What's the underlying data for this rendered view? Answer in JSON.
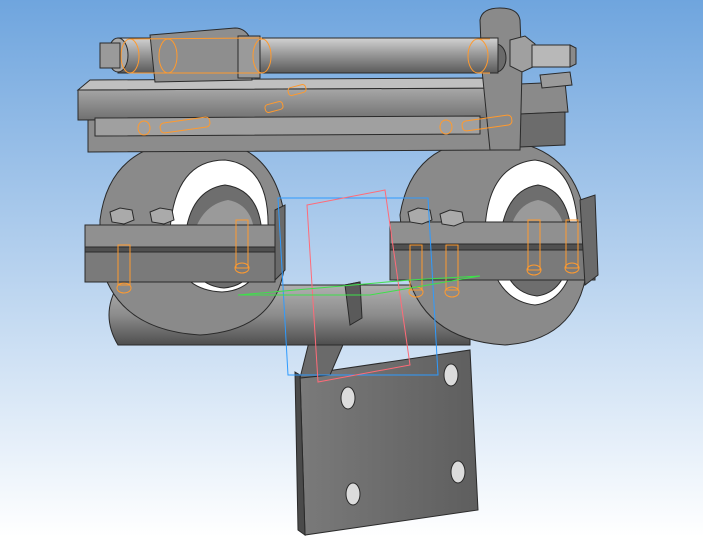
{
  "viewport": {
    "background_top": "#6fa5de",
    "background_bottom": "#ffffff",
    "model_fill": "#8a8a8a",
    "model_dark": "#545454",
    "model_light": "#b4b4b4",
    "model_edge": "#2a2a2a",
    "highlight_color": "#ff9a2e",
    "plane_front_color": "#2e9bff",
    "plane_right_color": "#ff6b78",
    "plane_top_color": "#3ee04a"
  }
}
